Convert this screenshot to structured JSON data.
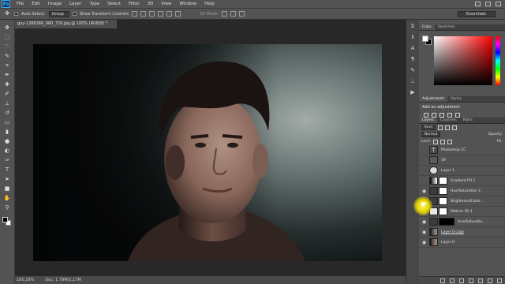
{
  "app": {
    "logo": "Ps"
  },
  "menu": [
    "File",
    "Edit",
    "Image",
    "Layer",
    "Type",
    "Select",
    "Filter",
    "3D",
    "View",
    "Window",
    "Help"
  ],
  "options_bar": {
    "auto_select_label": "Auto-Select:",
    "auto_select_value": "Group",
    "show_transform_label": "Show Transform Controls",
    "mode_3d_label": "3D Mode:",
    "workspace": "Essentials"
  },
  "document": {
    "tab_title": "guy-1266366_960_720.jpg @ 100% (RGB/8) *",
    "zoom": "100.29%",
    "doc_info": "Doc: 1.79M/1.17M"
  },
  "tools": [
    "move",
    "marquee",
    "lasso",
    "quick-select",
    "crop",
    "eyedropper",
    "spot-heal",
    "brush",
    "clone-stamp",
    "history-brush",
    "eraser",
    "gradient",
    "blur",
    "dodge",
    "pen",
    "type",
    "path-select",
    "rectangle",
    "hand",
    "zoom"
  ],
  "panels": {
    "color_tabs": [
      "Color",
      "Swatches"
    ],
    "adjust_tabs": [
      "Adjustments",
      "Styles"
    ],
    "adjust_title": "Add an adjustment",
    "layers_tabs": [
      "Layers",
      "Channels",
      "Paths"
    ],
    "kind_label": "Kind",
    "blend_mode": "Normal",
    "opacity_label": "Opacity:",
    "lock_label": "Lock:",
    "fill_label": "Fill:",
    "layers": [
      {
        "name": "Photoshop CC",
        "kind": "type",
        "visible": false
      },
      {
        "name": "19",
        "kind": "text",
        "visible": false
      },
      {
        "name": "Layer 1",
        "kind": "logo",
        "visible": false
      },
      {
        "name": "Gradient Fill 1",
        "kind": "adjust",
        "visible": false
      },
      {
        "name": "Hue/Saturation 1",
        "kind": "adjust",
        "visible": true
      },
      {
        "name": "Brightness/Contr...",
        "kind": "adjust",
        "visible": true
      },
      {
        "name": "Pattern Fill 1",
        "kind": "adjust",
        "visible": true
      },
      {
        "name": "Hue/Saturatio...",
        "kind": "adjust",
        "visible": true
      },
      {
        "name": "Layer 0 copy",
        "kind": "photo",
        "visible": true
      },
      {
        "name": "Layer 0",
        "kind": "photo",
        "visible": true
      }
    ]
  }
}
